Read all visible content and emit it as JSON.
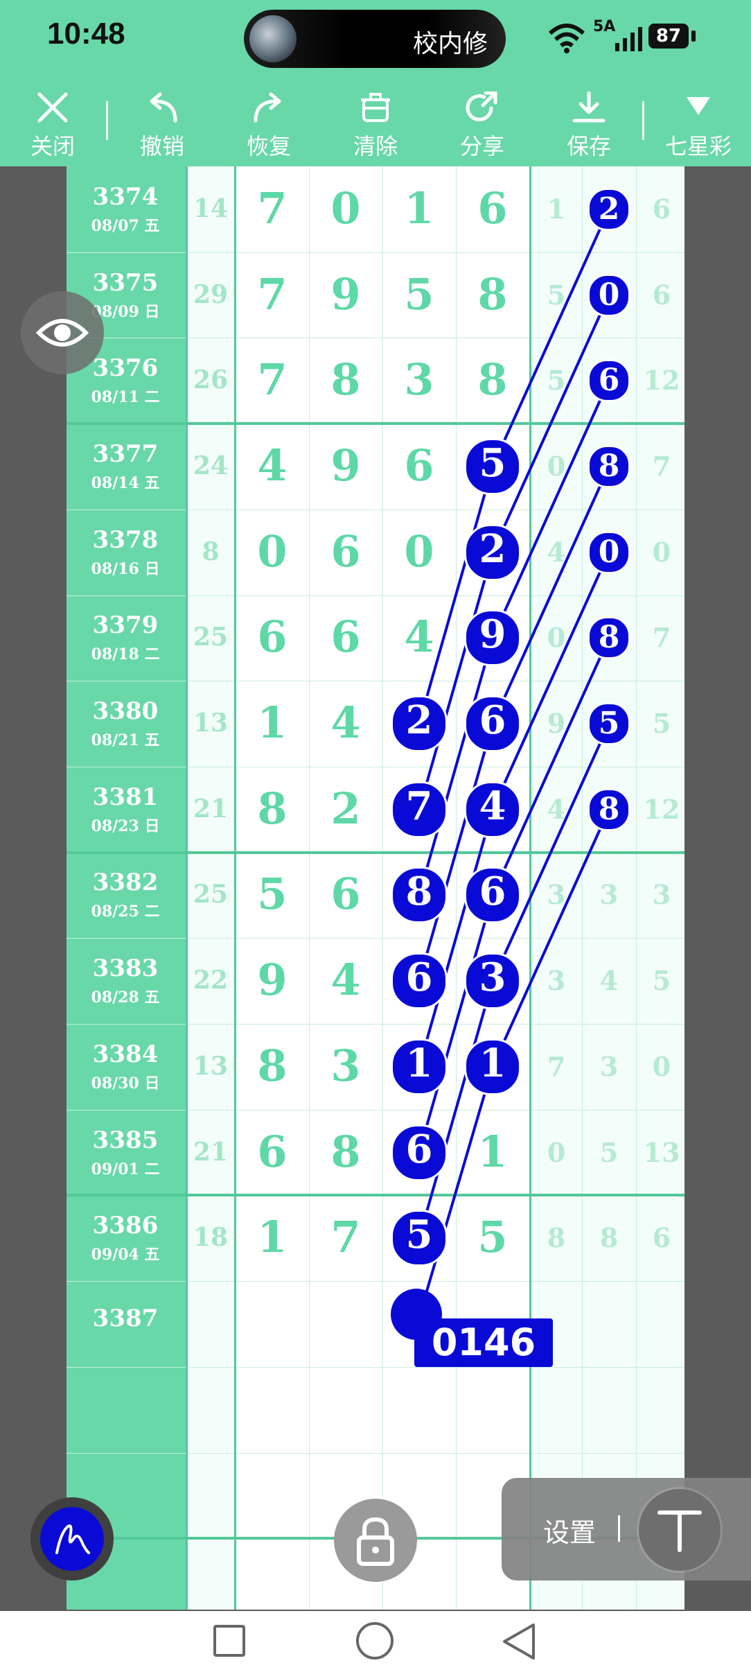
{
  "status": {
    "time": "10:48",
    "island_text": "校内修",
    "network": "5A",
    "battery": "87"
  },
  "toolbar": [
    {
      "label": "关闭",
      "icon": "close-icon"
    },
    {
      "label": "撤销",
      "icon": "undo-icon"
    },
    {
      "label": "恢复",
      "icon": "redo-icon"
    },
    {
      "label": "清除",
      "icon": "trash-icon"
    },
    {
      "label": "分享",
      "icon": "share-icon"
    },
    {
      "label": "保存",
      "icon": "download-icon"
    },
    {
      "label": "七星彩",
      "icon": "dropdown-triangle-icon"
    }
  ],
  "rows": [
    {
      "period": "3374",
      "date": "08/07 五",
      "sum": "14",
      "d": [
        "7",
        "0",
        "1",
        "6"
      ],
      "r": [
        "1",
        "2",
        "6"
      ]
    },
    {
      "period": "3375",
      "date": "08/09 日",
      "sum": "29",
      "d": [
        "7",
        "9",
        "5",
        "8"
      ],
      "r": [
        "5",
        "0",
        "6"
      ]
    },
    {
      "period": "3376",
      "date": "08/11 二",
      "sum": "26",
      "d": [
        "7",
        "8",
        "3",
        "8"
      ],
      "r": [
        "5",
        "6",
        "12"
      ]
    },
    {
      "period": "3377",
      "date": "08/14 五",
      "sum": "24",
      "d": [
        "4",
        "9",
        "6",
        "5"
      ],
      "r": [
        "0",
        "8",
        "7"
      ]
    },
    {
      "period": "3378",
      "date": "08/16 日",
      "sum": "8",
      "d": [
        "0",
        "6",
        "0",
        "2"
      ],
      "r": [
        "4",
        "0",
        "0"
      ]
    },
    {
      "period": "3379",
      "date": "08/18 二",
      "sum": "25",
      "d": [
        "6",
        "6",
        "4",
        "9"
      ],
      "r": [
        "0",
        "8",
        "7"
      ]
    },
    {
      "period": "3380",
      "date": "08/21 五",
      "sum": "13",
      "d": [
        "1",
        "4",
        "2",
        "6"
      ],
      "r": [
        "9",
        "5",
        "5"
      ]
    },
    {
      "period": "3381",
      "date": "08/23 日",
      "sum": "21",
      "d": [
        "8",
        "2",
        "7",
        "4"
      ],
      "r": [
        "4",
        "8",
        "12"
      ]
    },
    {
      "period": "3382",
      "date": "08/25 二",
      "sum": "25",
      "d": [
        "5",
        "6",
        "8",
        "6"
      ],
      "r": [
        "3",
        "3",
        "3"
      ]
    },
    {
      "period": "3383",
      "date": "08/28 五",
      "sum": "22",
      "d": [
        "9",
        "4",
        "6",
        "3"
      ],
      "r": [
        "3",
        "4",
        "5"
      ]
    },
    {
      "period": "3384",
      "date": "08/30 日",
      "sum": "13",
      "d": [
        "8",
        "3",
        "1",
        "1"
      ],
      "r": [
        "7",
        "3",
        "0"
      ]
    },
    {
      "period": "3385",
      "date": "09/01 二",
      "sum": "21",
      "d": [
        "6",
        "8",
        "6",
        "1"
      ],
      "r": [
        "0",
        "5",
        "13"
      ]
    },
    {
      "period": "3386",
      "date": "09/04 五",
      "sum": "18",
      "d": [
        "1",
        "7",
        "5",
        "5"
      ],
      "r": [
        "8",
        "8",
        "6"
      ]
    },
    {
      "period": "3387",
      "date": "",
      "sum": "",
      "d": [
        "",
        "",
        "",
        ""
      ],
      "r": [
        "",
        "",
        ""
      ]
    }
  ],
  "highlight_label": "0146十",
  "settings_label": "设置"
}
